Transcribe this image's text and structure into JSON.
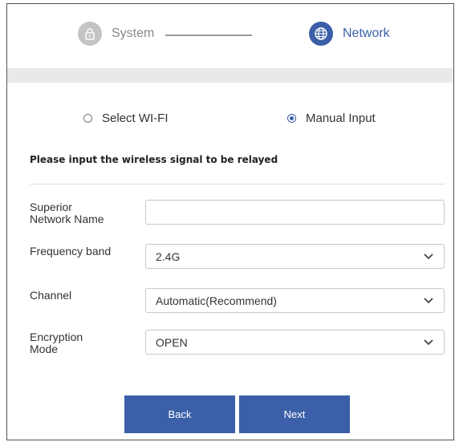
{
  "stepper": {
    "steps": [
      {
        "label": "System",
        "icon": "lock-icon",
        "state": "done"
      },
      {
        "label": "Network",
        "icon": "globe-icon",
        "state": "active"
      }
    ]
  },
  "mode": {
    "options": [
      {
        "label": "Select WI-FI",
        "checked": false
      },
      {
        "label": "Manual Input",
        "checked": true
      }
    ]
  },
  "instruction": "Please input the wireless signal to be relayed",
  "form": {
    "network_name": {
      "label_line1": "Superior",
      "label_line2": "Network Name",
      "value": ""
    },
    "frequency": {
      "label": "Frequency band",
      "value": "2.4G"
    },
    "channel": {
      "label": "Channel",
      "value": "Automatic(Recommend)"
    },
    "encryption": {
      "label_line1": "Encryption",
      "label_line2": "Mode",
      "value": "OPEN"
    }
  },
  "buttons": {
    "back": "Back",
    "next": "Next"
  },
  "colors": {
    "accent": "#3b5fa8",
    "inactive_step": "#c4c4c4",
    "band": "#e9e9e9"
  }
}
